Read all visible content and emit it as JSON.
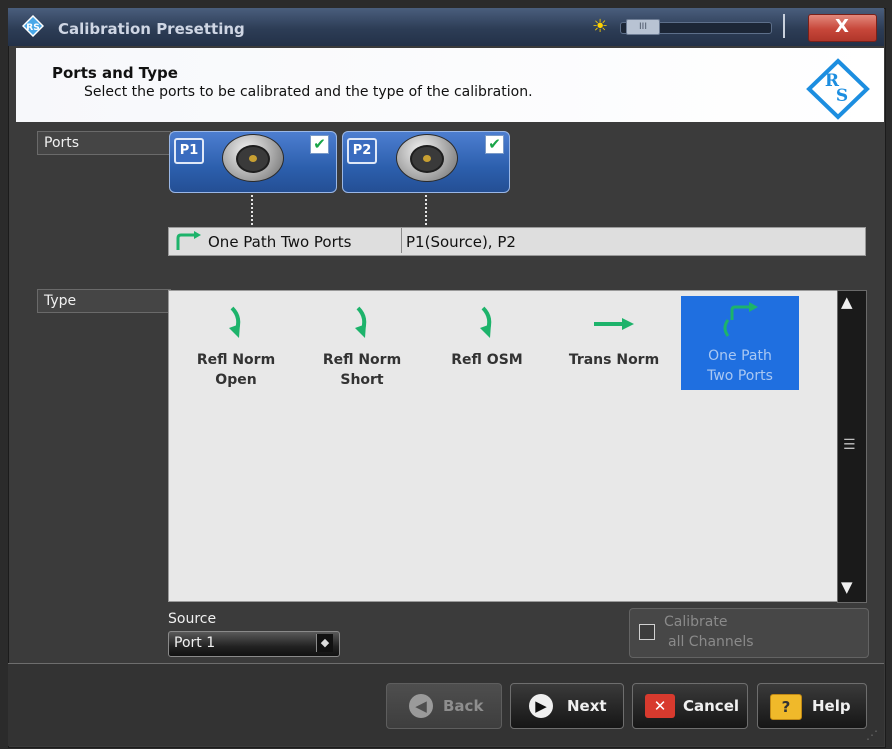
{
  "window": {
    "title": "Calibration Presetting",
    "close_label": "X",
    "brightness_thumb": "III"
  },
  "header": {
    "title": "Ports and Type",
    "description": "Select the ports to be calibrated and the type of the calibration."
  },
  "ports_section": {
    "label": "Ports",
    "ports": [
      {
        "tag": "P1",
        "checked": true
      },
      {
        "tag": "P2",
        "checked": true
      }
    ],
    "path_name": "One Path Two Ports",
    "path_ports": "P1(Source), P2"
  },
  "type_section": {
    "label": "Type",
    "items": [
      {
        "line1": "Refl Norm",
        "line2": "Open",
        "icon": "reflect-arrow-icon",
        "selected": false
      },
      {
        "line1": "Refl Norm",
        "line2": "Short",
        "icon": "reflect-arrow-icon",
        "selected": false
      },
      {
        "line1": "Refl OSM",
        "line2": "",
        "icon": "reflect-arrow-icon",
        "selected": false
      },
      {
        "line1": "Trans Norm",
        "line2": "",
        "icon": "transmission-arrow-icon",
        "selected": false
      },
      {
        "line1": "One Path",
        "line2": "Two Ports",
        "icon": "one-path-arrow-icon",
        "selected": true
      }
    ]
  },
  "source": {
    "label": "Source",
    "value": "Port 1"
  },
  "calibrate_all": {
    "line1": "Calibrate",
    "line2": "all Channels",
    "checked": false
  },
  "buttons": {
    "back": "Back",
    "next": "Next",
    "cancel": "Cancel",
    "help": "Help"
  },
  "colors": {
    "selected": "#1f6fe0",
    "arrow": "#1db36b",
    "port": "#2c5fad"
  }
}
